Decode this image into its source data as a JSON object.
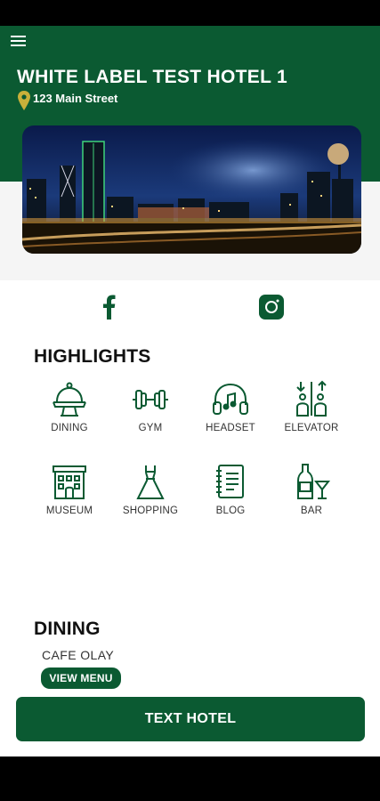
{
  "header": {
    "title": "WHITE LABEL TEST HOTEL 1",
    "address": "123 Main Street",
    "menu_icon": "hamburger-menu-icon",
    "pin_icon": "location-pin-icon",
    "pin_color": "#c9b03a"
  },
  "hero": {
    "image": "city-skyline-night"
  },
  "social": [
    {
      "name": "facebook",
      "icon": "facebook-icon"
    },
    {
      "name": "instagram",
      "icon": "instagram-icon"
    }
  ],
  "highlights": {
    "title": "HIGHLIGHTS",
    "items": [
      {
        "label": "DINING",
        "icon": "dining-cloche-icon"
      },
      {
        "label": "GYM",
        "icon": "dumbbell-icon"
      },
      {
        "label": "HEADSET",
        "icon": "headphones-icon"
      },
      {
        "label": "ELEVATOR",
        "icon": "elevator-icon"
      },
      {
        "label": "MUSEUM",
        "icon": "museum-building-icon"
      },
      {
        "label": "SHOPPING",
        "icon": "dress-icon"
      },
      {
        "label": "BLOG",
        "icon": "notebook-icon"
      },
      {
        "label": "BAR",
        "icon": "wine-bottle-glass-icon"
      }
    ]
  },
  "dining": {
    "title": "DINING",
    "restaurant": "CAFE OLAY",
    "button": "VIEW MENU"
  },
  "cta": {
    "label": "TEXT HOTEL"
  },
  "colors": {
    "brand": "#0b5a32",
    "white": "#ffffff"
  }
}
